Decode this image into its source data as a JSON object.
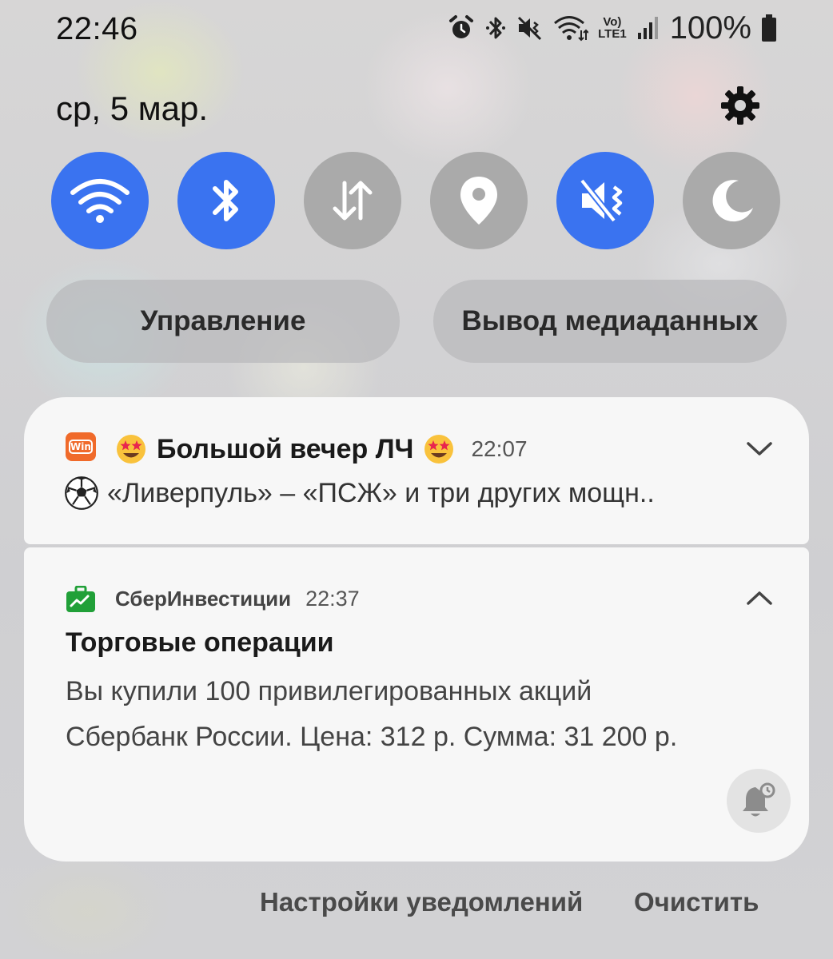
{
  "status_bar": {
    "time": "22:46",
    "battery_text": "100%",
    "lte_top": "Vo)",
    "lte_bottom": "LTE1",
    "icons": [
      "alarm-icon",
      "bluetooth-icon",
      "mute-icon",
      "wifi-icon",
      "volte-icon",
      "signal-icon",
      "battery-icon"
    ]
  },
  "header": {
    "date": "ср, 5 мар.",
    "settings_icon": "gear-icon"
  },
  "quick_toggles": [
    {
      "name": "wifi",
      "icon": "wifi-icon",
      "active": true
    },
    {
      "name": "bluetooth",
      "icon": "bluetooth-icon",
      "active": true
    },
    {
      "name": "mobile-data",
      "icon": "data-arrows-icon",
      "active": false
    },
    {
      "name": "location",
      "icon": "location-pin-icon",
      "active": false
    },
    {
      "name": "sound-mute",
      "icon": "mute-vibrate-icon",
      "active": true
    },
    {
      "name": "night-mode",
      "icon": "moon-icon",
      "active": false
    }
  ],
  "buttons": {
    "device_control": "Управление",
    "media_output": "Вывод медиаданных"
  },
  "notifications": [
    {
      "app_icon": "win-app-icon",
      "title": "Большой вечер ЛЧ",
      "time": "22:07",
      "body": "«Ливерпуль» – «ПСЖ» и три других мощн..",
      "title_emoji": "star-struck-emoji",
      "body_emoji": "soccer-ball-emoji",
      "expanded": false
    },
    {
      "app_icon": "sber-investments-icon",
      "app_name": "СберИнвестиции",
      "time": "22:37",
      "title": "Торговые операции",
      "body_line1": "Вы купили 100 привилегированных акций",
      "body_line2": "Сбербанк России. Цена: 312 р. Сумма: 31 200 р.",
      "expanded": true
    }
  ],
  "footer": {
    "notification_settings": "Настройки уведомлений",
    "clear": "Очистить"
  },
  "colors": {
    "toggle_on": "#3a73f0",
    "toggle_off": "#aaaaaa",
    "card_bg": "#f7f7f7",
    "sber_green": "#21a038",
    "win_orange": "#f06a2a"
  }
}
